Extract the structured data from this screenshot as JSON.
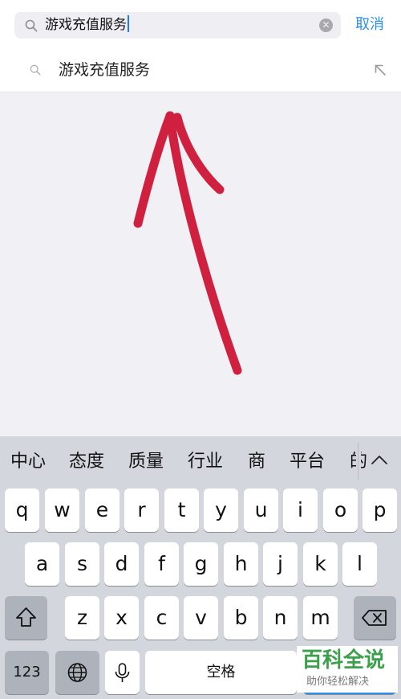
{
  "search": {
    "query": "游戏充值服务",
    "cancel_label": "取消"
  },
  "suggestion": {
    "text": "游戏充值服务"
  },
  "icons": {
    "search": "search-icon",
    "clear": "clear-icon",
    "fill": "arrow-up-left-icon",
    "expand": "chevron-up-icon",
    "shift": "shift-icon",
    "globe": "globe-icon",
    "mic": "microphone-icon",
    "delete": "backspace-icon"
  },
  "colors": {
    "accent": "#2a8ff2",
    "annotation": "#d0203f",
    "watermark": "#3aa14a"
  },
  "candidates": [
    "中心",
    "态度",
    "质量",
    "行业",
    "商",
    "平台",
    "的"
  ],
  "keyboard": {
    "row1": [
      "q",
      "w",
      "e",
      "r",
      "t",
      "y",
      "u",
      "i",
      "o",
      "p"
    ],
    "row2": [
      "a",
      "s",
      "d",
      "f",
      "g",
      "h",
      "j",
      "k",
      "l"
    ],
    "row3": [
      "z",
      "x",
      "c",
      "v",
      "b",
      "n",
      "m"
    ],
    "numbers_label": "123",
    "space_label": "空格"
  },
  "watermark": {
    "title": "百科全说",
    "subtitle": "助你轻松解决"
  }
}
